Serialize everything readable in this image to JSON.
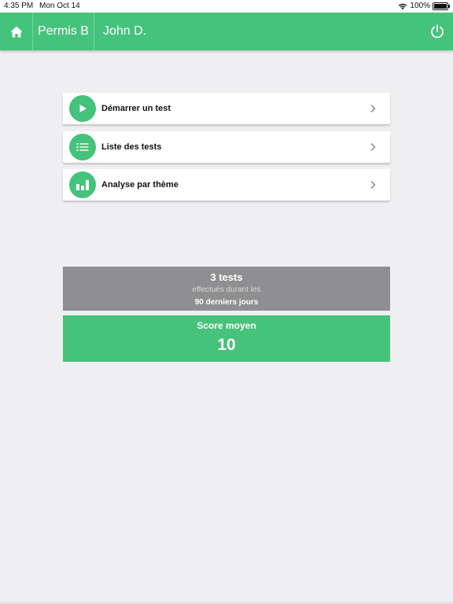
{
  "status_bar": {
    "time": "4:35 PM",
    "date": "Mon Oct 14",
    "battery": "100%",
    "icons": [
      "wifi-icon",
      "battery-icon"
    ]
  },
  "header": {
    "home_icon": "home-icon",
    "permis_label": "Permis B",
    "user_label": "John D.",
    "power_icon": "power-icon"
  },
  "menu": [
    {
      "label": "Démarrer un test",
      "icon": "play-icon"
    },
    {
      "label": "Liste des tests",
      "icon": "list-icon"
    },
    {
      "label": "Analyse par thème",
      "icon": "bar-chart-icon"
    }
  ],
  "stats": {
    "count_label": "3 tests",
    "sub_label": "effectués durant les",
    "days_label": "90 derniers jours"
  },
  "score": {
    "title": "Score moyen",
    "value": "10"
  },
  "colors": {
    "accent": "#45c27b",
    "stats_bg": "#8f8e90",
    "background": "#efeef0"
  }
}
